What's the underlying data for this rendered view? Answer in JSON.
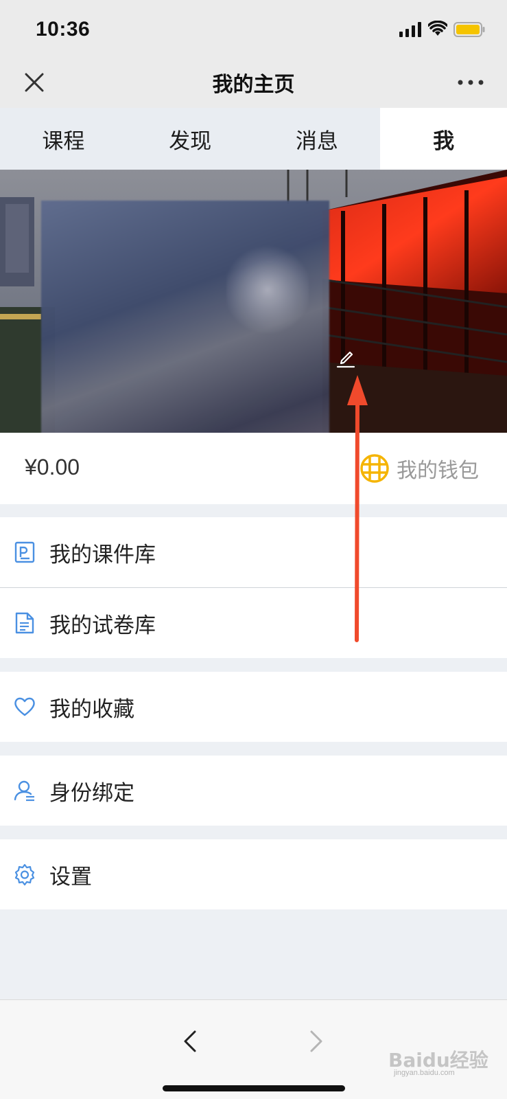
{
  "status_bar": {
    "time": "10:36"
  },
  "header": {
    "title": "我的主页"
  },
  "tabs": [
    {
      "label": "课程",
      "active": false
    },
    {
      "label": "发现",
      "active": false
    },
    {
      "label": "消息",
      "active": false
    },
    {
      "label": "我",
      "active": true
    }
  ],
  "wallet": {
    "balance": "¥0.00",
    "label": "我的钱包"
  },
  "menu": [
    {
      "label": "我的课件库",
      "icon": "courseware-icon"
    },
    {
      "label": "我的试卷库",
      "icon": "document-icon"
    },
    {
      "label": "我的收藏",
      "icon": "heart-icon"
    },
    {
      "label": "身份绑定",
      "icon": "user-bind-icon"
    },
    {
      "label": "设置",
      "icon": "gear-icon"
    }
  ],
  "watermark": {
    "text": "Baidu经验",
    "sub": "jingyan.baidu.com"
  },
  "colors": {
    "accent_blue": "#4a90e2",
    "wallet_gold": "#f5b400",
    "annotation_red": "#f04a2c"
  }
}
